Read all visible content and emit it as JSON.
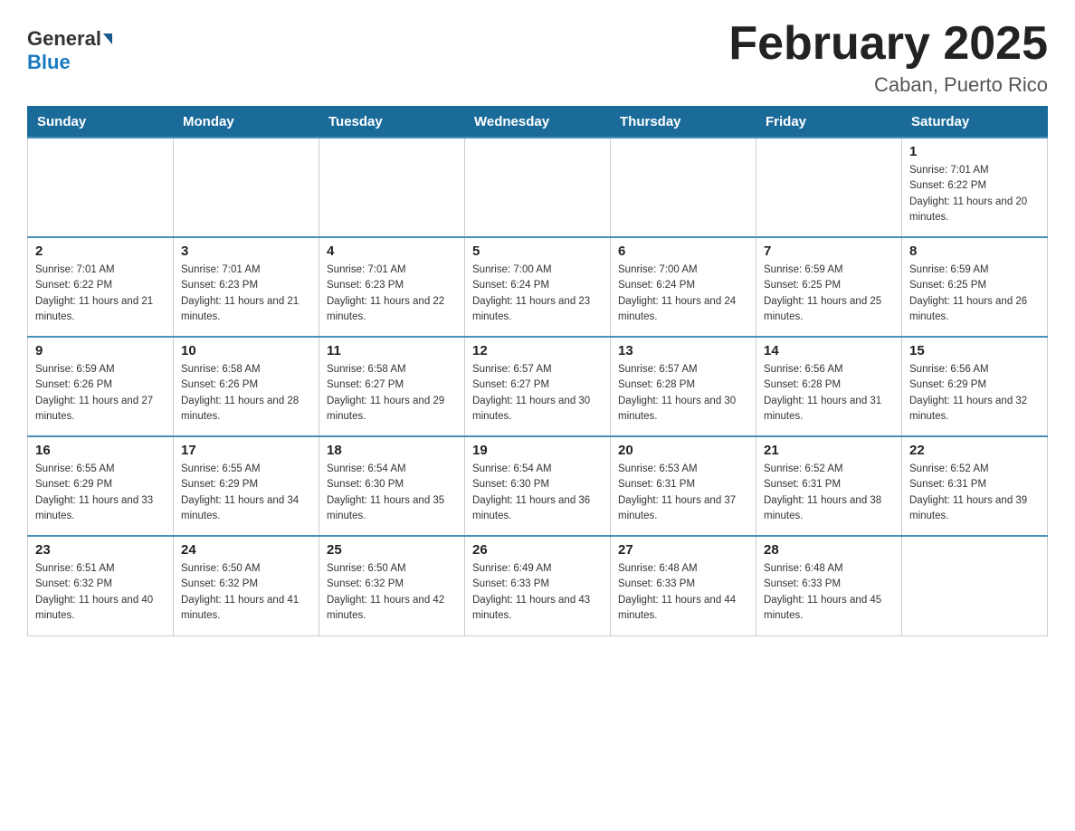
{
  "header": {
    "logo_general": "General",
    "logo_blue": "Blue",
    "month_title": "February 2025",
    "location": "Caban, Puerto Rico"
  },
  "days_of_week": [
    "Sunday",
    "Monday",
    "Tuesday",
    "Wednesday",
    "Thursday",
    "Friday",
    "Saturday"
  ],
  "weeks": [
    {
      "days": [
        {
          "number": "",
          "info": ""
        },
        {
          "number": "",
          "info": ""
        },
        {
          "number": "",
          "info": ""
        },
        {
          "number": "",
          "info": ""
        },
        {
          "number": "",
          "info": ""
        },
        {
          "number": "",
          "info": ""
        },
        {
          "number": "1",
          "info": "Sunrise: 7:01 AM\nSunset: 6:22 PM\nDaylight: 11 hours and 20 minutes."
        }
      ]
    },
    {
      "days": [
        {
          "number": "2",
          "info": "Sunrise: 7:01 AM\nSunset: 6:22 PM\nDaylight: 11 hours and 21 minutes."
        },
        {
          "number": "3",
          "info": "Sunrise: 7:01 AM\nSunset: 6:23 PM\nDaylight: 11 hours and 21 minutes."
        },
        {
          "number": "4",
          "info": "Sunrise: 7:01 AM\nSunset: 6:23 PM\nDaylight: 11 hours and 22 minutes."
        },
        {
          "number": "5",
          "info": "Sunrise: 7:00 AM\nSunset: 6:24 PM\nDaylight: 11 hours and 23 minutes."
        },
        {
          "number": "6",
          "info": "Sunrise: 7:00 AM\nSunset: 6:24 PM\nDaylight: 11 hours and 24 minutes."
        },
        {
          "number": "7",
          "info": "Sunrise: 6:59 AM\nSunset: 6:25 PM\nDaylight: 11 hours and 25 minutes."
        },
        {
          "number": "8",
          "info": "Sunrise: 6:59 AM\nSunset: 6:25 PM\nDaylight: 11 hours and 26 minutes."
        }
      ]
    },
    {
      "days": [
        {
          "number": "9",
          "info": "Sunrise: 6:59 AM\nSunset: 6:26 PM\nDaylight: 11 hours and 27 minutes."
        },
        {
          "number": "10",
          "info": "Sunrise: 6:58 AM\nSunset: 6:26 PM\nDaylight: 11 hours and 28 minutes."
        },
        {
          "number": "11",
          "info": "Sunrise: 6:58 AM\nSunset: 6:27 PM\nDaylight: 11 hours and 29 minutes."
        },
        {
          "number": "12",
          "info": "Sunrise: 6:57 AM\nSunset: 6:27 PM\nDaylight: 11 hours and 30 minutes."
        },
        {
          "number": "13",
          "info": "Sunrise: 6:57 AM\nSunset: 6:28 PM\nDaylight: 11 hours and 30 minutes."
        },
        {
          "number": "14",
          "info": "Sunrise: 6:56 AM\nSunset: 6:28 PM\nDaylight: 11 hours and 31 minutes."
        },
        {
          "number": "15",
          "info": "Sunrise: 6:56 AM\nSunset: 6:29 PM\nDaylight: 11 hours and 32 minutes."
        }
      ]
    },
    {
      "days": [
        {
          "number": "16",
          "info": "Sunrise: 6:55 AM\nSunset: 6:29 PM\nDaylight: 11 hours and 33 minutes."
        },
        {
          "number": "17",
          "info": "Sunrise: 6:55 AM\nSunset: 6:29 PM\nDaylight: 11 hours and 34 minutes."
        },
        {
          "number": "18",
          "info": "Sunrise: 6:54 AM\nSunset: 6:30 PM\nDaylight: 11 hours and 35 minutes."
        },
        {
          "number": "19",
          "info": "Sunrise: 6:54 AM\nSunset: 6:30 PM\nDaylight: 11 hours and 36 minutes."
        },
        {
          "number": "20",
          "info": "Sunrise: 6:53 AM\nSunset: 6:31 PM\nDaylight: 11 hours and 37 minutes."
        },
        {
          "number": "21",
          "info": "Sunrise: 6:52 AM\nSunset: 6:31 PM\nDaylight: 11 hours and 38 minutes."
        },
        {
          "number": "22",
          "info": "Sunrise: 6:52 AM\nSunset: 6:31 PM\nDaylight: 11 hours and 39 minutes."
        }
      ]
    },
    {
      "days": [
        {
          "number": "23",
          "info": "Sunrise: 6:51 AM\nSunset: 6:32 PM\nDaylight: 11 hours and 40 minutes."
        },
        {
          "number": "24",
          "info": "Sunrise: 6:50 AM\nSunset: 6:32 PM\nDaylight: 11 hours and 41 minutes."
        },
        {
          "number": "25",
          "info": "Sunrise: 6:50 AM\nSunset: 6:32 PM\nDaylight: 11 hours and 42 minutes."
        },
        {
          "number": "26",
          "info": "Sunrise: 6:49 AM\nSunset: 6:33 PM\nDaylight: 11 hours and 43 minutes."
        },
        {
          "number": "27",
          "info": "Sunrise: 6:48 AM\nSunset: 6:33 PM\nDaylight: 11 hours and 44 minutes."
        },
        {
          "number": "28",
          "info": "Sunrise: 6:48 AM\nSunset: 6:33 PM\nDaylight: 11 hours and 45 minutes."
        },
        {
          "number": "",
          "info": ""
        }
      ]
    }
  ]
}
